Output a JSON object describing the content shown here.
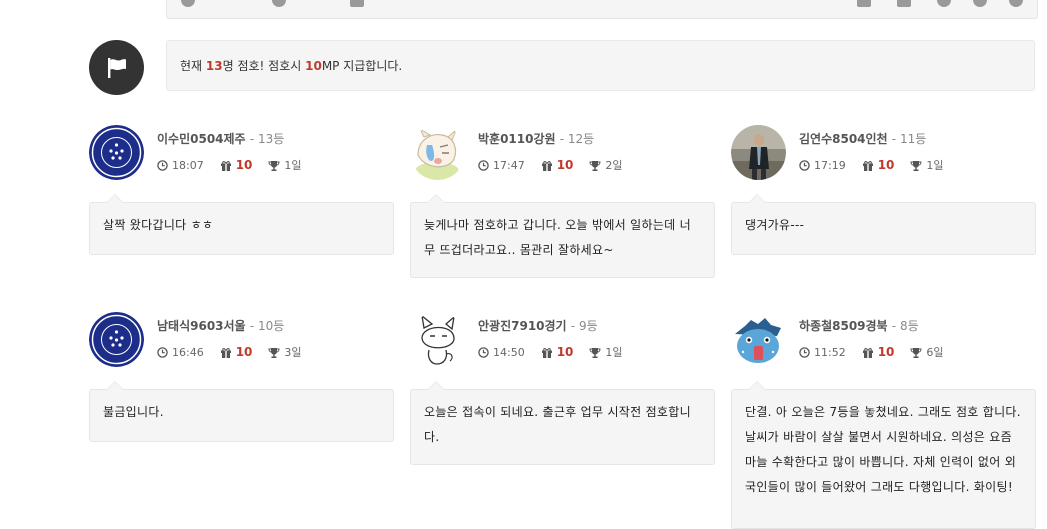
{
  "notice": {
    "prefix": "현재 ",
    "count": "13",
    "mid": "명 점호! 점호시 ",
    "mp": "10",
    "suffix": "MP 지급합니다."
  },
  "entries": [
    {
      "name": "이수민0504제주",
      "rank": "- 13등",
      "time": "18:07",
      "points": "10",
      "days": "1일",
      "message": "살짝 왔다갑니다 ㅎㅎ",
      "avatar": "badge"
    },
    {
      "name": "박훈0110강원",
      "rank": "- 12등",
      "time": "17:47",
      "points": "10",
      "days": "2일",
      "message": "늦게나마 점호하고 갑니다. 오늘 밖에서 일하는데 너무 뜨겁더라고요.. 몸관리 잘하세요~",
      "avatar": "cartoon"
    },
    {
      "name": "김연수8504인천",
      "rank": "- 11등",
      "time": "17:19",
      "points": "10",
      "days": "1일",
      "message": "댕겨가유---",
      "avatar": "photo"
    },
    {
      "name": "남태식9603서울",
      "rank": "- 10등",
      "time": "16:46",
      "points": "10",
      "days": "3일",
      "message": "불금입니다.",
      "avatar": "badge"
    },
    {
      "name": "안광진7910경기",
      "rank": "- 9등",
      "time": "14:50",
      "points": "10",
      "days": "1일",
      "message": "오늘은 접속이 되네요. 출근후 업무 시작전 점호합니다.",
      "avatar": "cat"
    },
    {
      "name": "하종철8509경북",
      "rank": "- 8등",
      "time": "11:52",
      "points": "10",
      "days": "6일",
      "message": "단결. 아 오늘은 7등을 놓쳤네요. 그래도 점호 합니다. 날씨가 바람이 살살 불면서 시원하네요. 의성은 요즘 마늘 수확한다고 많이 바쁩니다. 자체 인력이 없어 외국인들이 많이 들어왔어 그래도 다행입니다. 화이팅!",
      "avatar": "blue"
    }
  ],
  "colors": {
    "accent": "#c0392b",
    "bubble": "#f5f5f5",
    "badge": "#1d2d8a"
  },
  "icons": {
    "time": "clock-icon",
    "points": "gift-icon",
    "days": "trophy-icon",
    "flag": "flag-icon"
  }
}
